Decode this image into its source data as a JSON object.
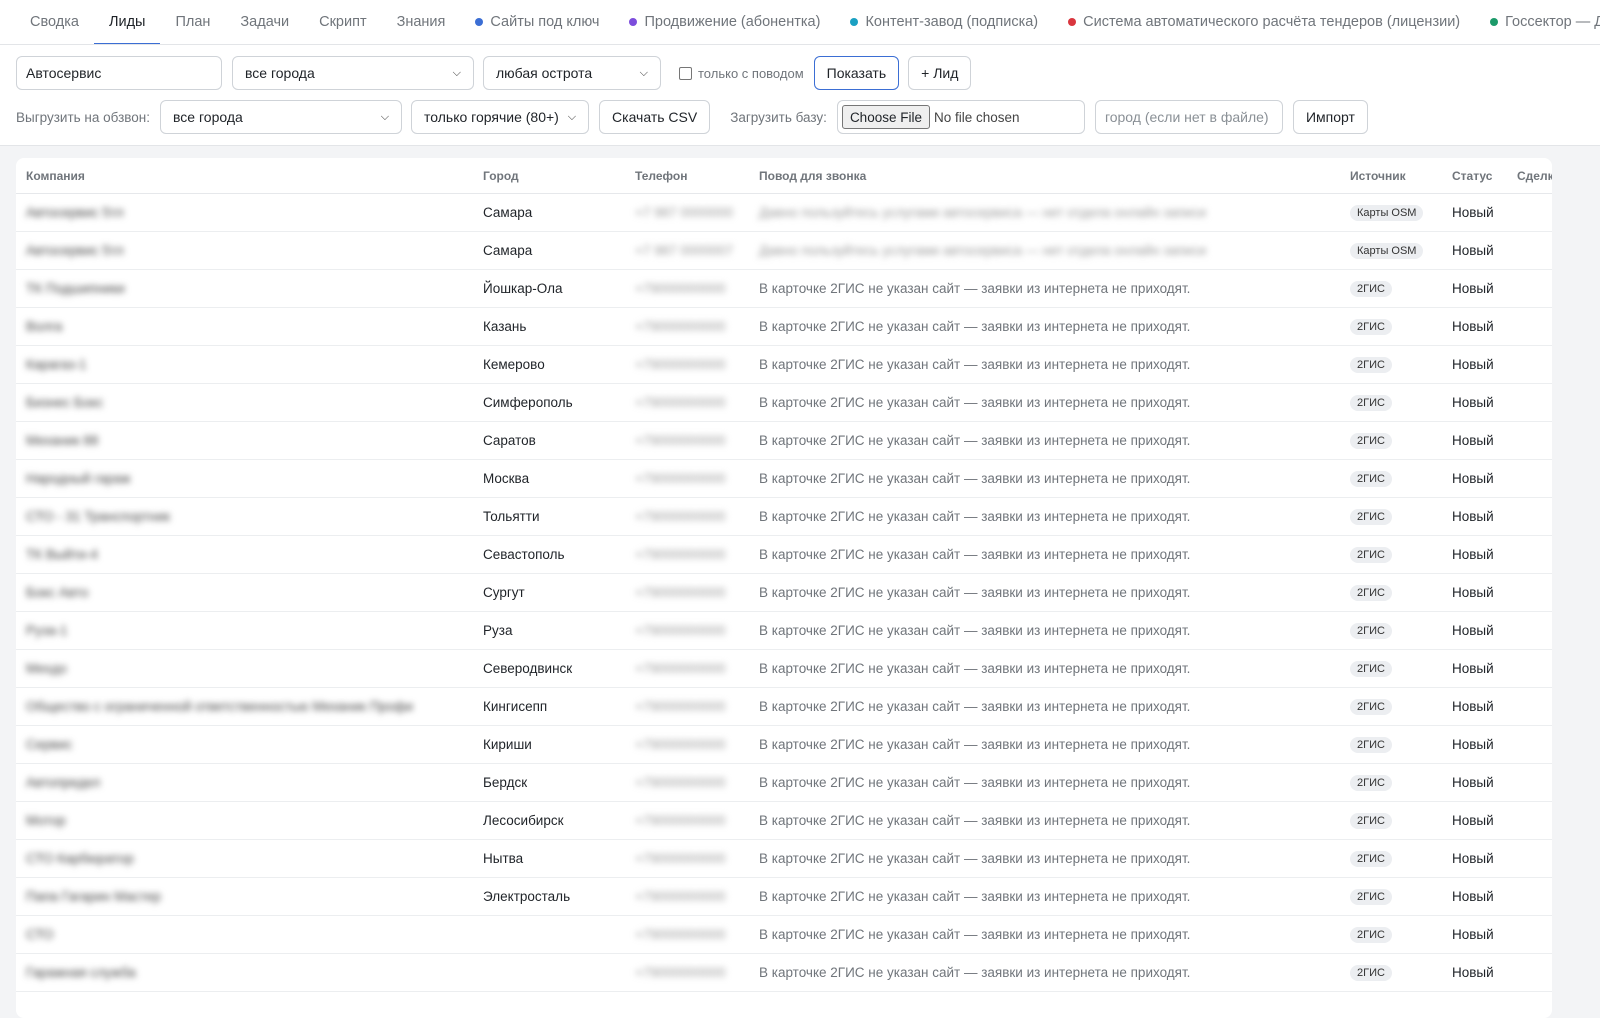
{
  "nav": {
    "tabs": [
      {
        "label": "Сводка",
        "active": false
      },
      {
        "label": "Лиды",
        "active": true
      },
      {
        "label": "План",
        "active": false
      },
      {
        "label": "Задачи",
        "active": false
      },
      {
        "label": "Скрипт",
        "active": false
      },
      {
        "label": "Знания",
        "active": false
      }
    ],
    "products": [
      {
        "label": "Сайты под ключ",
        "color": "#3b6ed4"
      },
      {
        "label": "Продвижение (абонентка)",
        "color": "#7c4ddc"
      },
      {
        "label": "Контент-завод (подписка)",
        "color": "#1aa0c2"
      },
      {
        "label": "Система автоматического расчёта тендеров (лицензии)",
        "color": "#d9363e"
      },
      {
        "label": "Госсектор — Дядя",
        "color": "#1c9a6a"
      }
    ]
  },
  "filters": {
    "search_value": "Автосервис",
    "city_select": "все города",
    "heat_select": "любая острота",
    "reason_checkbox": "только с поводом",
    "show_button": "Показать",
    "add_lead_button": "+ Лид"
  },
  "export": {
    "label": "Выгрузить на обзвон:",
    "city_select": "все города",
    "heat_select": "только горячие (80+)",
    "csv_button": "Скачать CSV",
    "upload_label": "Загрузить базу:",
    "file_button": "Choose File",
    "file_status": "No file chosen",
    "city_placeholder": "город (если нет в файле)",
    "import_button": "Импорт"
  },
  "table": {
    "headers": [
      "Компания",
      "Город",
      "Телефон",
      "Повод для звонка",
      "Источник",
      "Статус",
      "Сделки"
    ],
    "rows": [
      {
        "company": "Автосервис 5тл",
        "city": "Самара",
        "phone": "+7 987 0000000",
        "reason": "Давно пользуйтесь услугами автосервиса — нет отдела онлайн записи",
        "source": "Карты OSM",
        "status": "Новый",
        "deals": "",
        "blur_reason": true
      },
      {
        "company": "Автосервис 5тл",
        "city": "Самара",
        "phone": "+7 987 0000007",
        "reason": "Давно пользуйтесь услугами автосервиса — нет отдела онлайн записи",
        "source": "Карты OSM",
        "status": "Новый",
        "deals": "",
        "blur_reason": true
      },
      {
        "company": "ТК Подшипники",
        "city": "Йошкар-Ола",
        "phone": "+79000000000",
        "reason": "В карточке 2ГИС не указан сайт — заявки из интернета не приходят.",
        "source": "2ГИС",
        "status": "Новый",
        "deals": ""
      },
      {
        "company": "Волга",
        "city": "Казань",
        "phone": "+79000000000",
        "reason": "В карточке 2ГИС не указан сайт — заявки из интернета не приходят.",
        "source": "2ГИС",
        "status": "Новый",
        "deals": ""
      },
      {
        "company": "Карагаз-1",
        "city": "Кемерово",
        "phone": "+79000000000",
        "reason": "В карточке 2ГИС не указан сайт — заявки из интернета не приходят.",
        "source": "2ГИС",
        "status": "Новый",
        "deals": ""
      },
      {
        "company": "Бизнес Бокс",
        "city": "Симферополь",
        "phone": "+79000000000",
        "reason": "В карточке 2ГИС не указан сайт — заявки из интернета не приходят.",
        "source": "2ГИС",
        "status": "Новый",
        "deals": ""
      },
      {
        "company": "Механик 88",
        "city": "Саратов",
        "phone": "+79000000000",
        "reason": "В карточке 2ГИС не указан сайт — заявки из интернета не приходят.",
        "source": "2ГИС",
        "status": "Новый",
        "deals": ""
      },
      {
        "company": "Народный гараж",
        "city": "Москва",
        "phone": "+79000000000",
        "reason": "В карточке 2ГИС не указан сайт — заявки из интернета не приходят.",
        "source": "2ГИС",
        "status": "Новый",
        "deals": ""
      },
      {
        "company": "СТО - 31 Транспортник",
        "city": "Тольятти",
        "phone": "+79000000000",
        "reason": "В карточке 2ГИС не указан сайт — заявки из интернета не приходят.",
        "source": "2ГИС",
        "status": "Новый",
        "deals": ""
      },
      {
        "company": "ТК Выйти-4",
        "city": "Севастополь",
        "phone": "+79000000000",
        "reason": "В карточке 2ГИС не указан сайт — заявки из интернета не приходят.",
        "source": "2ГИС",
        "status": "Новый",
        "deals": ""
      },
      {
        "company": "Бокс Авто",
        "city": "Сургут",
        "phone": "+79000000000",
        "reason": "В карточке 2ГИС не указан сайт — заявки из интернета не приходят.",
        "source": "2ГИС",
        "status": "Новый",
        "deals": ""
      },
      {
        "company": "Руза-1",
        "city": "Руза",
        "phone": "+79000000000",
        "reason": "В карточке 2ГИС не указан сайт — заявки из интернета не приходят.",
        "source": "2ГИС",
        "status": "Новый",
        "deals": ""
      },
      {
        "company": "Мехдо",
        "city": "Северодвинск",
        "phone": "+79000000000",
        "reason": "В карточке 2ГИС не указан сайт — заявки из интернета не приходят.",
        "source": "2ГИС",
        "status": "Новый",
        "deals": ""
      },
      {
        "company": "Общество с ограниченной ответственностью Механик Профи",
        "city": "Кингисепп",
        "phone": "+79000000000",
        "reason": "В карточке 2ГИС не указан сайт — заявки из интернета не приходят.",
        "source": "2ГИС",
        "status": "Новый",
        "deals": ""
      },
      {
        "company": "Сервис",
        "city": "Кириши",
        "phone": "+79000000000",
        "reason": "В карточке 2ГИС не указан сайт — заявки из интернета не приходят.",
        "source": "2ГИС",
        "status": "Новый",
        "deals": ""
      },
      {
        "company": "Автопредел",
        "city": "Бердск",
        "phone": "+79000000000",
        "reason": "В карточке 2ГИС не указан сайт — заявки из интернета не приходят.",
        "source": "2ГИС",
        "status": "Новый",
        "deals": ""
      },
      {
        "company": "Мотор",
        "city": "Лесосибирск",
        "phone": "+79000000000",
        "reason": "В карточке 2ГИС не указан сайт — заявки из интернета не приходят.",
        "source": "2ГИС",
        "status": "Новый",
        "deals": ""
      },
      {
        "company": "СТО Карбюратор",
        "city": "Нытва",
        "phone": "+79000000000",
        "reason": "В карточке 2ГИС не указан сайт — заявки из интернета не приходят.",
        "source": "2ГИС",
        "status": "Новый",
        "deals": ""
      },
      {
        "company": "Папа Гагарин Мастер",
        "city": "Электросталь",
        "phone": "+79000000000",
        "reason": "В карточке 2ГИС не указан сайт — заявки из интернета не приходят.",
        "source": "2ГИС",
        "status": "Новый",
        "deals": ""
      },
      {
        "company": "СТО",
        "city": "",
        "phone": "+79000000000",
        "reason": "В карточке 2ГИС не указан сайт — заявки из интернета не приходят.",
        "source": "2ГИС",
        "status": "Новый",
        "deals": ""
      },
      {
        "company": "Гаражная служба",
        "city": "",
        "phone": "+79000000000",
        "reason": "В карточке 2ГИС не указан сайт — заявки из интернета не приходят.",
        "source": "2ГИС",
        "status": "Новый",
        "deals": ""
      }
    ]
  }
}
